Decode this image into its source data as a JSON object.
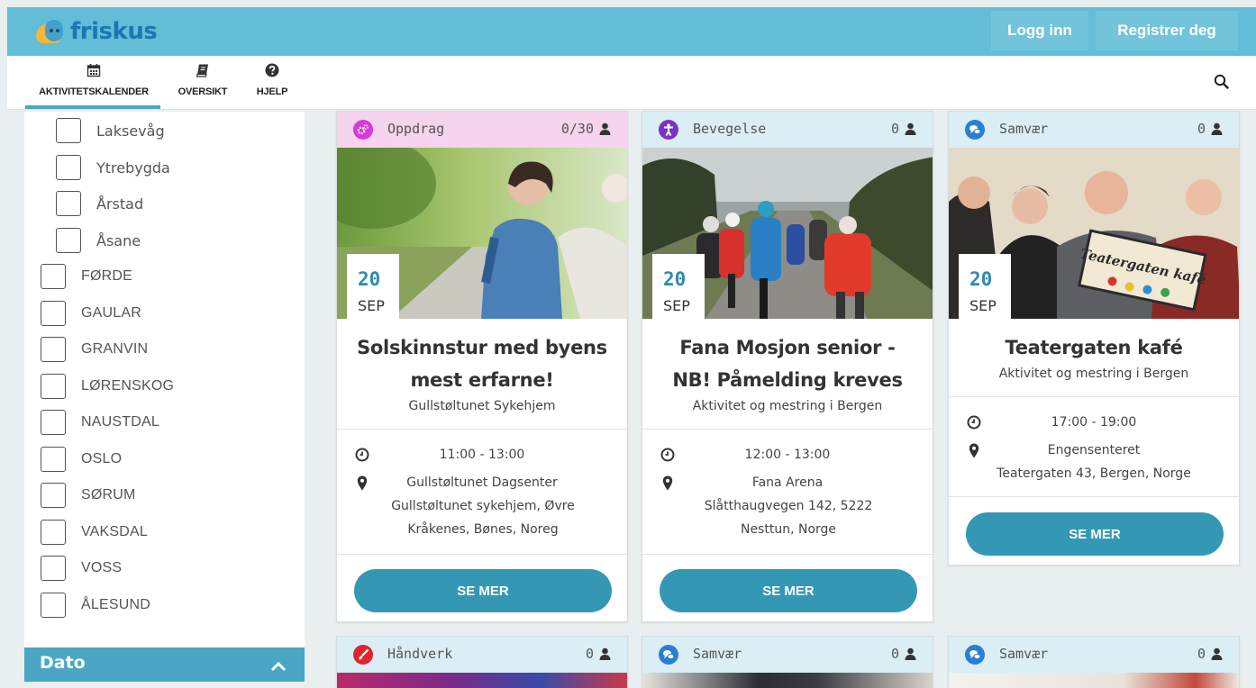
{
  "header": {
    "logo_text": "friskus",
    "login_label": "Logg inn",
    "register_label": "Registrer deg"
  },
  "nav": {
    "tabs": [
      {
        "label": "AKTIVITETSKALENDER",
        "icon": "calendar-icon",
        "active": true
      },
      {
        "label": "OVERSIKT",
        "icon": "book-icon"
      },
      {
        "label": "HJELP",
        "icon": "question-icon"
      }
    ],
    "search_icon": "search-icon"
  },
  "sidebar": {
    "sub_locations": [
      "Laksevåg",
      "Ytrebygda",
      "Årstad",
      "Åsane"
    ],
    "municipalities": [
      "FØRDE",
      "GAULAR",
      "GRANVIN",
      "LØRENSKOG",
      "NAUSTDAL",
      "OSLO",
      "SØRUM",
      "VAKSDAL",
      "VOSS",
      "ÅLESUND"
    ],
    "dato_label": "Dato"
  },
  "colors": {
    "brand": "#63bdd6",
    "accent": "#3498b5",
    "oppdrag": "#d63ad8",
    "bevegelse": "#7b2fcc",
    "samvaer": "#2a7fd4",
    "handverk": "#e0252c"
  },
  "cards": [
    {
      "category": "Oppdrag",
      "count": "0/30",
      "day": "20",
      "month": "SEP",
      "title": "Solskinnstur med byens mest erfarne!",
      "organizer": "Gullstøltunet Sykehjem",
      "time": "11:00 - 13:00",
      "location_name": "Gullstøltunet Dagsenter",
      "address": "Gullstøltunet sykehjem, Øvre Kråkenes, Bønes, Noreg",
      "button": "SE MER"
    },
    {
      "category": "Bevegelse",
      "count": "0",
      "day": "20",
      "month": "SEP",
      "title": "Fana Mosjon senior - NB! Påmelding kreves",
      "organizer": "Aktivitet og mestring i Bergen",
      "time": "12:00 - 13:00",
      "location_name": "Fana Arena",
      "address": "Slåtthaugvegen 142, 5222 Nesttun, Norge",
      "button": "SE MER"
    },
    {
      "category": "Samvær",
      "count": "0",
      "day": "20",
      "month": "SEP",
      "title": "Teatergaten kafé",
      "organizer": "Aktivitet og mestring i Bergen",
      "time": "17:00 - 19:00",
      "location_name": "Engensenteret",
      "address": "Teatergaten 43, Bergen, Norge",
      "sign_text": "Teatergaten kafé",
      "button": "SE MER"
    },
    {
      "category": "Håndverk",
      "count": "0"
    },
    {
      "category": "Samvær",
      "count": "0"
    },
    {
      "category": "Samvær",
      "count": "0"
    }
  ]
}
